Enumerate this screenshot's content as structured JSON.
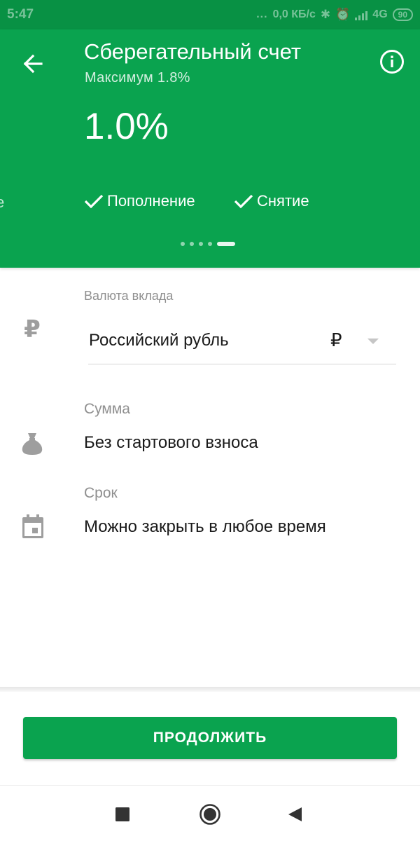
{
  "status_bar": {
    "time": "5:47",
    "dots": "...",
    "network_speed": "0,0 КБ/с",
    "network_type": "4G",
    "battery": "90"
  },
  "header": {
    "title": "Сберегательный счет",
    "subtitle": "Максимум 1.8%",
    "rate": "1.0%",
    "prev_card_peek": "е",
    "features": [
      "Пополнение",
      "Снятие"
    ],
    "pager": {
      "total": 5,
      "active_index": 4
    },
    "icons": {
      "back": "arrow-left-icon",
      "info": "info-icon",
      "feature": "check-icon"
    }
  },
  "form": {
    "currency": {
      "label": "Валюта вклада",
      "value": "Российский рубль",
      "symbol": "₽",
      "icon": "ruble-icon",
      "icon_glyph": "₽"
    },
    "amount": {
      "label": "Сумма",
      "value": "Без стартового взноса",
      "icon": "money-bag-icon"
    },
    "term": {
      "label": "Срок",
      "value": "Можно закрыть в любое время",
      "icon": "calendar-icon"
    }
  },
  "actions": {
    "continue_label": "ПРОДОЛЖИТЬ"
  },
  "nav_bar": {
    "icons": [
      "recents-square-icon",
      "home-circle-icon",
      "back-triangle-icon"
    ]
  },
  "colors": {
    "header_green": "#0aa34f",
    "status_green": "#089144",
    "button_green": "#0aa34f",
    "icon_gray": "#9e9e9e"
  }
}
